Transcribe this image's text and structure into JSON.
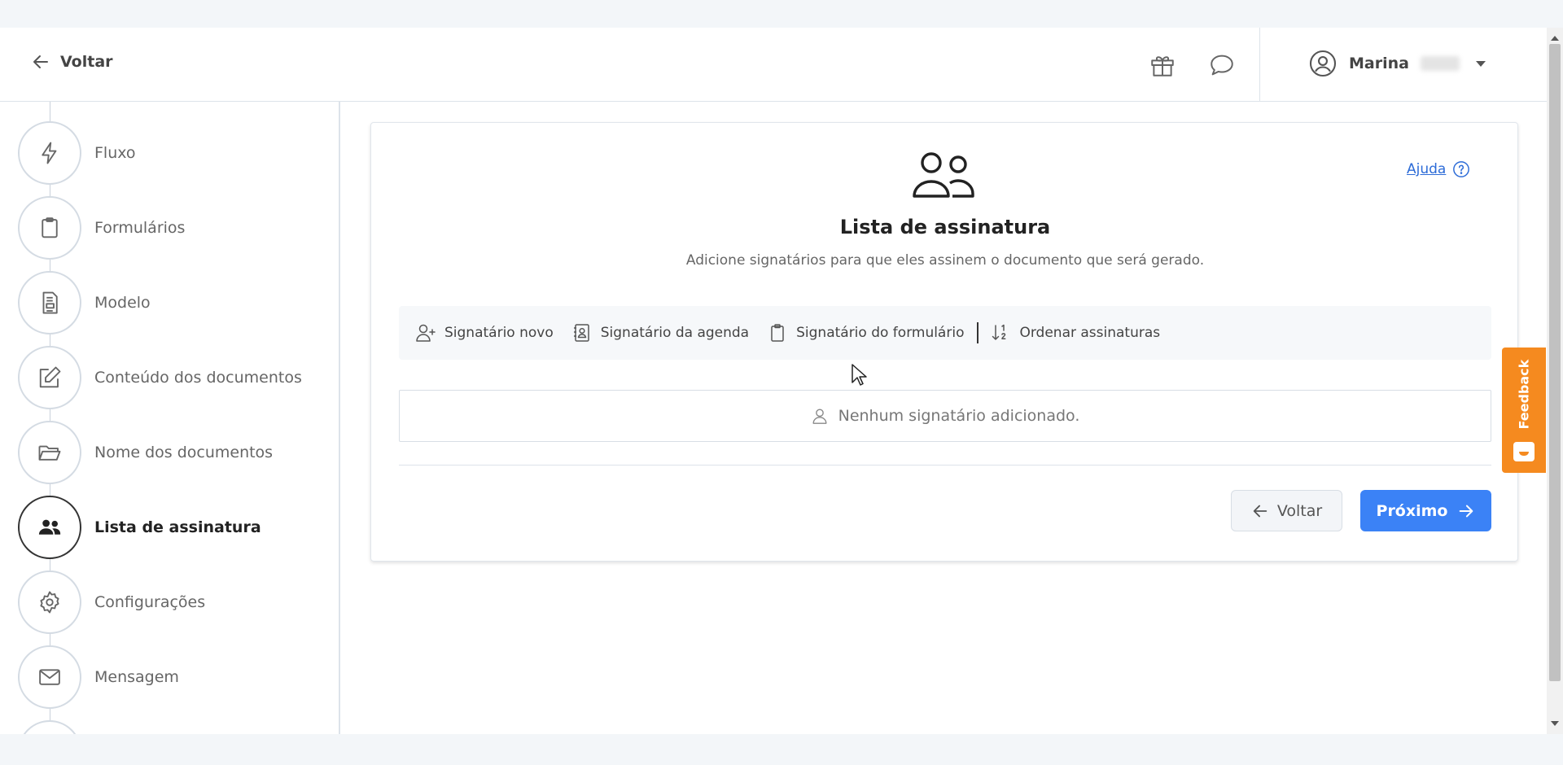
{
  "header": {
    "back_label": "Voltar",
    "user_name": "Marina",
    "icons": [
      "gift-icon",
      "chat-icon",
      "user-icon"
    ]
  },
  "sidebar": {
    "steps": [
      {
        "label": "Fluxo",
        "icon": "bolt-icon",
        "active": false
      },
      {
        "label": "Formulários",
        "icon": "clipboard-icon",
        "active": false
      },
      {
        "label": "Modelo",
        "icon": "template-icon",
        "active": false
      },
      {
        "label": "Conteúdo dos documentos",
        "icon": "edit-icon",
        "active": false
      },
      {
        "label": "Nome dos documentos",
        "icon": "folder-icon",
        "active": false
      },
      {
        "label": "Lista de assinatura",
        "icon": "users-icon",
        "active": true
      },
      {
        "label": "Configurações",
        "icon": "gear-icon",
        "active": false
      },
      {
        "label": "Mensagem",
        "icon": "envelope-icon",
        "active": false
      }
    ]
  },
  "main": {
    "help_label": "Ajuda",
    "title": "Lista de assinatura",
    "subtitle": "Adicione signatários para que eles assinem o documento que será gerado.",
    "toolbar": {
      "new_signer": "Signatário novo",
      "agenda_signer": "Signatário da agenda",
      "form_signer": "Signatário do formulário",
      "order_signatures": "Ordenar assinaturas"
    },
    "empty_message": "Nenhum signatário adicionado.",
    "back_button": "Voltar",
    "next_button": "Próximo"
  },
  "feedback": {
    "label": "Feedback",
    "color": "#f58a1f"
  },
  "colors": {
    "primary": "#3b82f6",
    "link": "#2c6bd7"
  }
}
